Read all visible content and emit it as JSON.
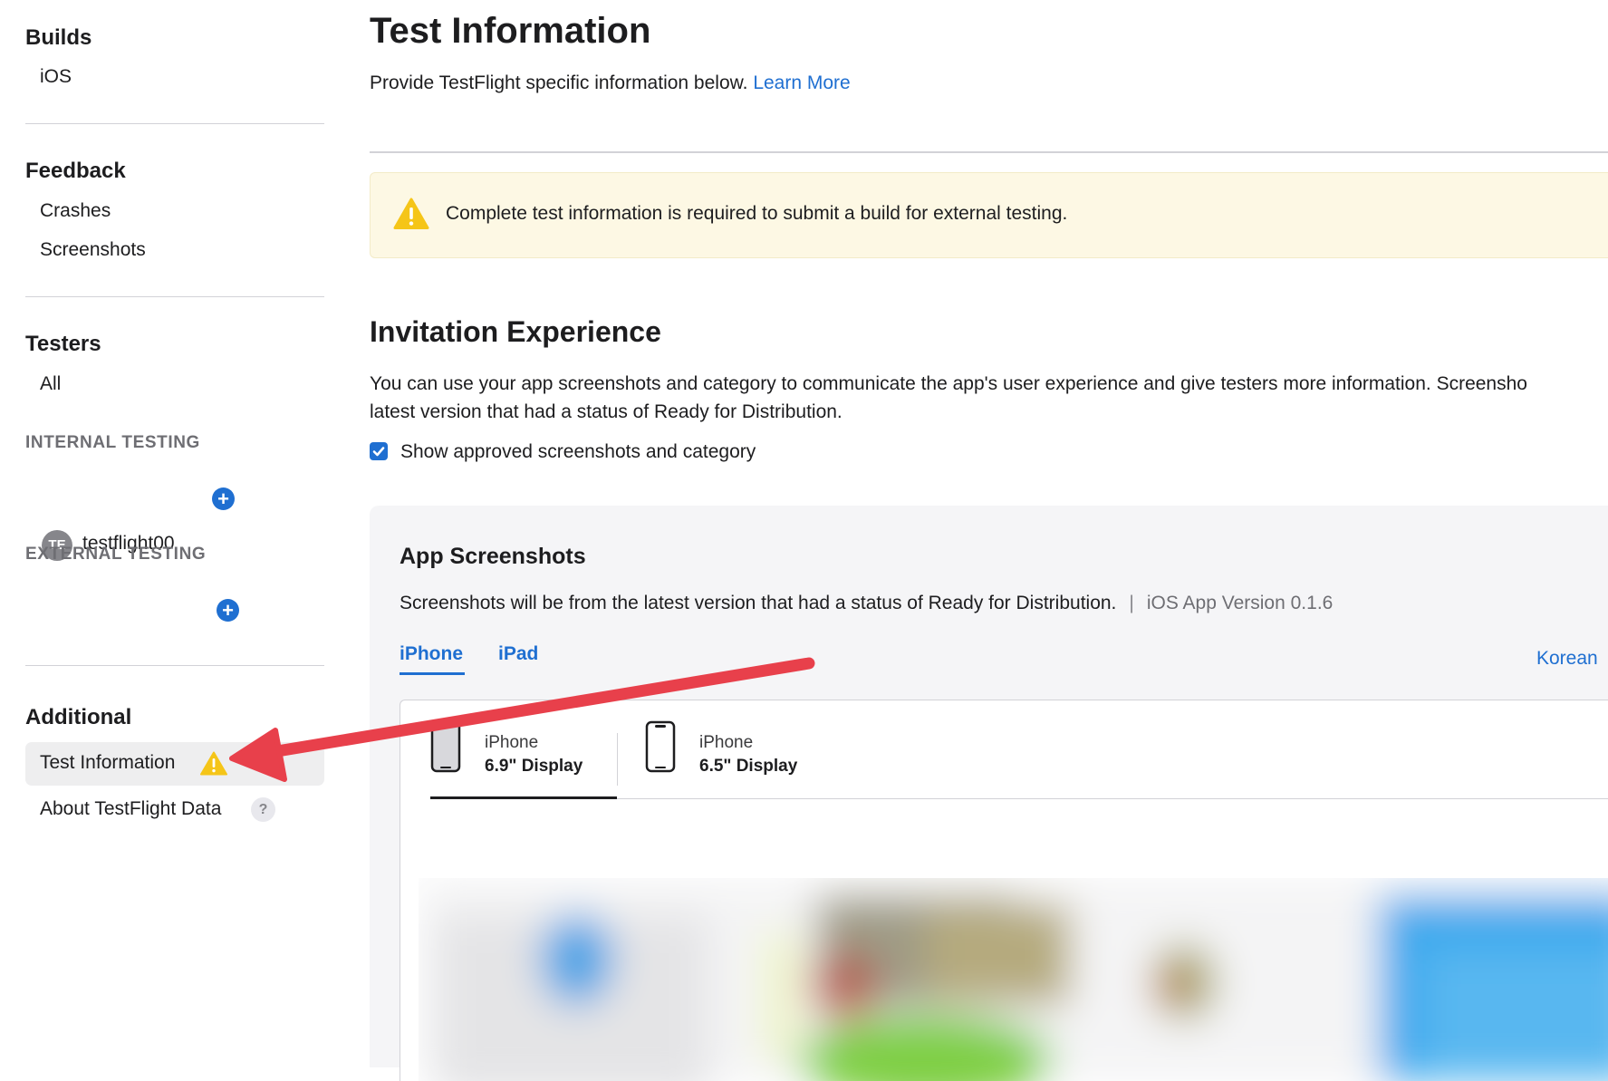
{
  "sidebar": {
    "builds": {
      "title": "Builds",
      "items": [
        "iOS"
      ]
    },
    "feedback": {
      "title": "Feedback",
      "items": [
        "Crashes",
        "Screenshots"
      ]
    },
    "testers": {
      "title": "Testers",
      "items": [
        "All"
      ],
      "internal_label": "INTERNAL TESTING",
      "internal_group": {
        "initials": "TE",
        "name": "testflight00"
      },
      "external_label": "EXTERNAL TESTING",
      "add_glyph": "+"
    },
    "additional": {
      "title": "Additional",
      "test_information": "Test Information",
      "about": "About TestFlight Data",
      "help_glyph": "?"
    }
  },
  "main": {
    "title": "Test Information",
    "intro": "Provide TestFlight specific information below.",
    "learn_more": "Learn More",
    "warning": "Complete test information is required to submit a build for external testing.",
    "invitation": {
      "title": "Invitation Experience",
      "line1": "You can use your app screenshots and category to communicate the app's user experience and give testers more information. Screensho",
      "line2": "latest version that had a status of Ready for Distribution.",
      "checkbox_label": "Show approved screenshots and category",
      "checkbox_checked": true
    },
    "app_screenshots": {
      "title": "App Screenshots",
      "description": "Screenshots will be from the latest version that had a status of Ready for Distribution.",
      "separator": "|",
      "version": "iOS App Version 0.1.6",
      "tabs": [
        "iPhone",
        "iPad"
      ],
      "selected_tab": "iPhone",
      "locale": "Korean",
      "devices": [
        {
          "kind": "iPhone",
          "size": "6.9\" Display",
          "selected": true
        },
        {
          "kind": "iPhone",
          "size": "6.5\" Display",
          "selected": false
        }
      ]
    }
  },
  "icons": {
    "warning": "warning-triangle-icon",
    "plus": "plus-circle-icon",
    "help": "question-circle-icon",
    "phone": "iphone-outline-icon",
    "check": "checkmark-icon",
    "arrow": "red-annotation-arrow"
  },
  "colors": {
    "accent": "#1f6fd1",
    "warning_yellow": "#f5c518",
    "warning_bg": "#fdf8e4",
    "annotation_red": "#e8404b",
    "selected_bg": "#eeeeef"
  }
}
